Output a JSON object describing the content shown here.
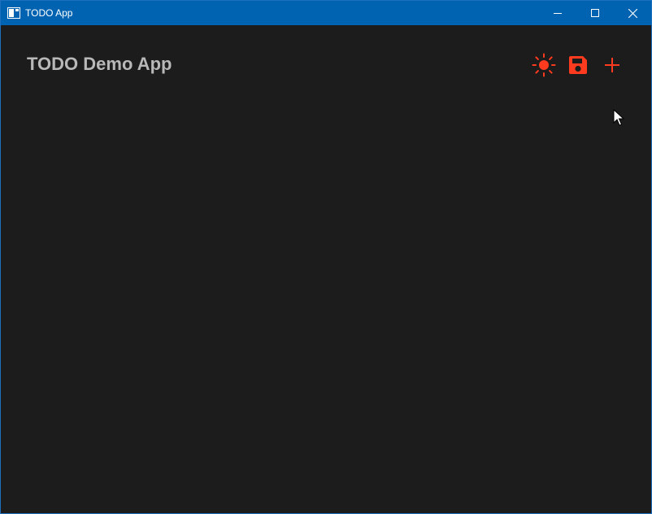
{
  "window": {
    "title": "TODO App",
    "titlebar_color": "#0063b1",
    "controls": [
      "minimize-icon",
      "maximize-icon",
      "close-icon"
    ]
  },
  "app": {
    "title": "TODO Demo App",
    "title_color": "#b8b8b8",
    "background": "#1c1c1c",
    "accent": "#ff3b1f"
  },
  "toolbar": {
    "buttons": [
      {
        "icon": "sun-icon",
        "action": "toggle-theme"
      },
      {
        "icon": "floppy-disk-icon",
        "action": "save"
      },
      {
        "icon": "plus-icon",
        "action": "add"
      }
    ]
  },
  "todo_list": {
    "items": []
  }
}
